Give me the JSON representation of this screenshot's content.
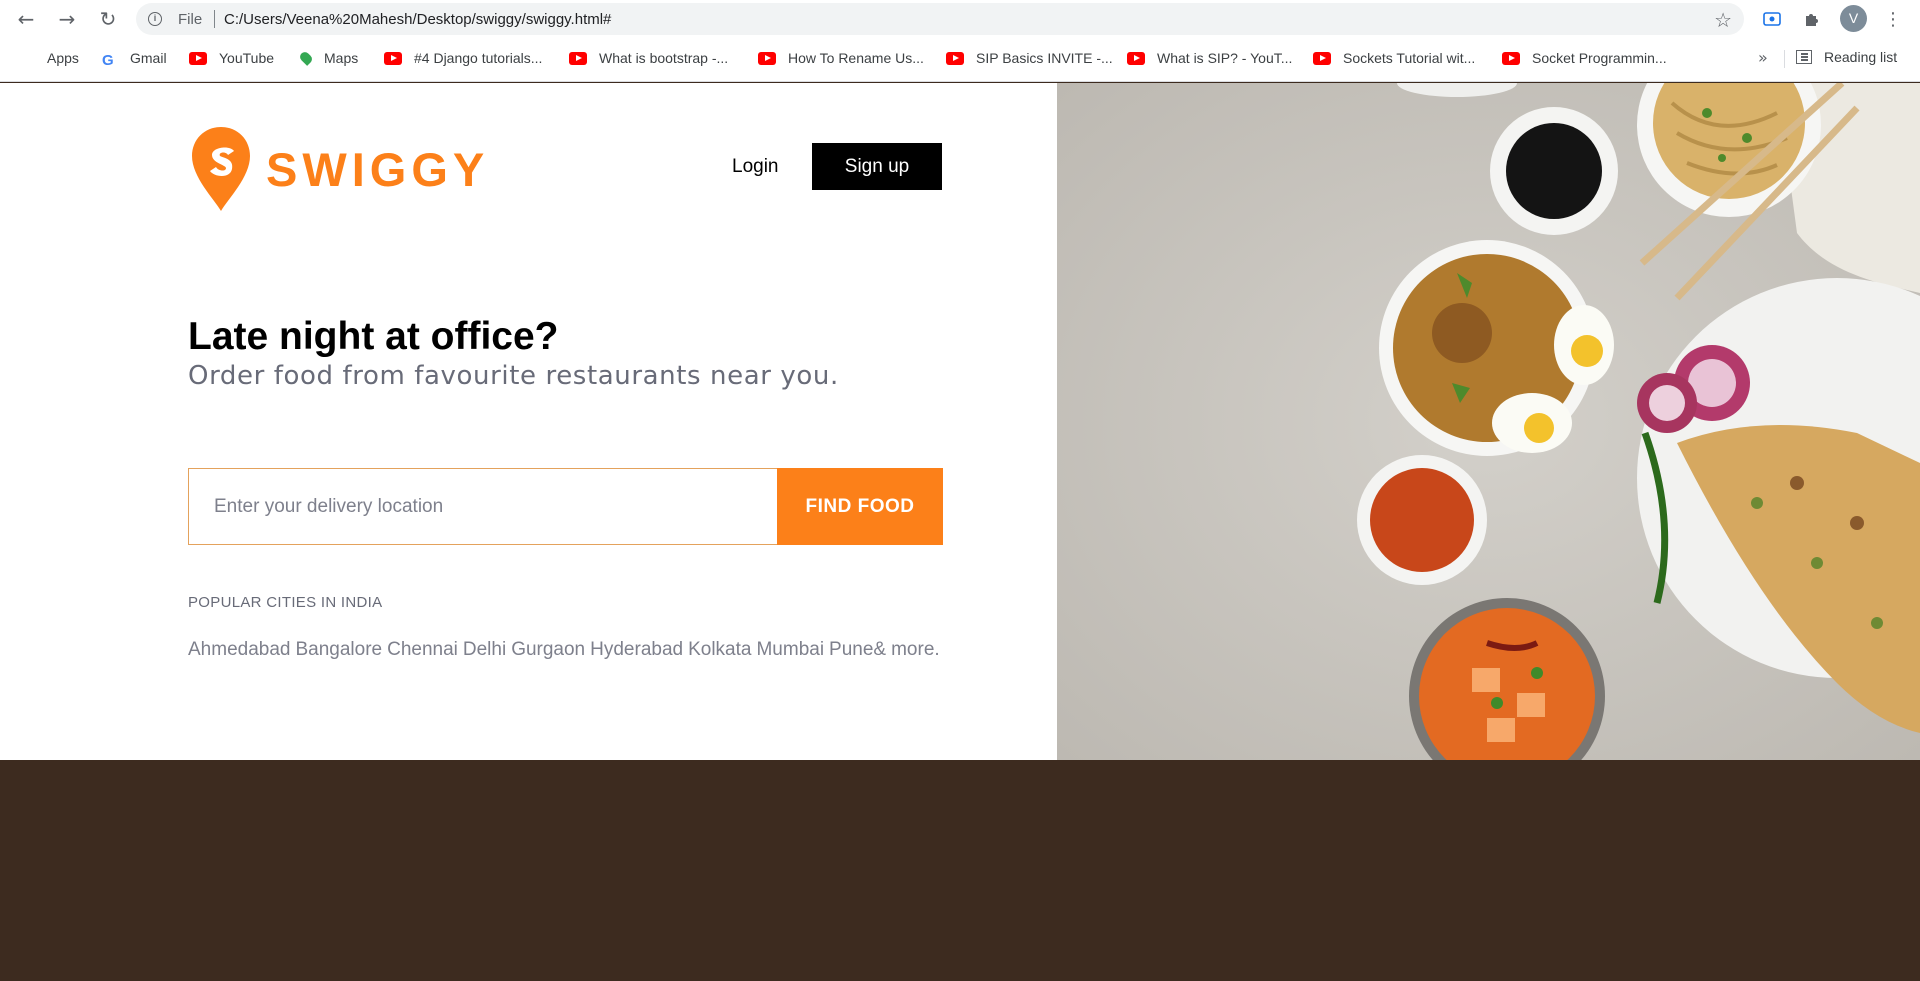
{
  "browser": {
    "file_label": "File",
    "url": "C:/Users/Veena%20Mahesh/Desktop/swiggy/swiggy.html#",
    "avatar_letter": "V",
    "more_bookmarks": "»",
    "reading_list": "Reading list",
    "bookmarks": [
      {
        "label": "Apps",
        "icon": "apps-icon"
      },
      {
        "label": "Gmail",
        "icon": "google-icon"
      },
      {
        "label": "YouTube",
        "icon": "youtube-icon"
      },
      {
        "label": "Maps",
        "icon": "maps-icon"
      },
      {
        "label": "#4 Django tutorials...",
        "icon": "youtube-icon"
      },
      {
        "label": "What is bootstrap -...",
        "icon": "youtube-icon"
      },
      {
        "label": "How To Rename Us...",
        "icon": "youtube-icon"
      },
      {
        "label": "SIP Basics INVITE -...",
        "icon": "youtube-icon"
      },
      {
        "label": "What is SIP? - YouT...",
        "icon": "youtube-icon"
      },
      {
        "label": "Sockets Tutorial wit...",
        "icon": "youtube-icon"
      },
      {
        "label": "Socket Programmin...",
        "icon": "youtube-icon"
      }
    ]
  },
  "header": {
    "logo_text": "SWIGGY",
    "login_label": "Login",
    "signup_label": "Sign up"
  },
  "hero": {
    "headline": "Late night at office?",
    "subhead": "Order food from favourite restaurants near you.",
    "search_placeholder": "Enter your delivery location",
    "find_food_label": "FIND FOOD",
    "cities_title": "POPULAR CITIES IN INDIA",
    "cities": [
      "Ahmedabad",
      "Bangalore",
      "Chennai",
      "Delhi",
      "Gurgaon",
      "Hyderabad",
      "Kolkata",
      "Mumbai",
      "Pune&"
    ],
    "cities_more": "more."
  },
  "colors": {
    "brand": "#fc8019",
    "footer": "#3d2b1f"
  }
}
